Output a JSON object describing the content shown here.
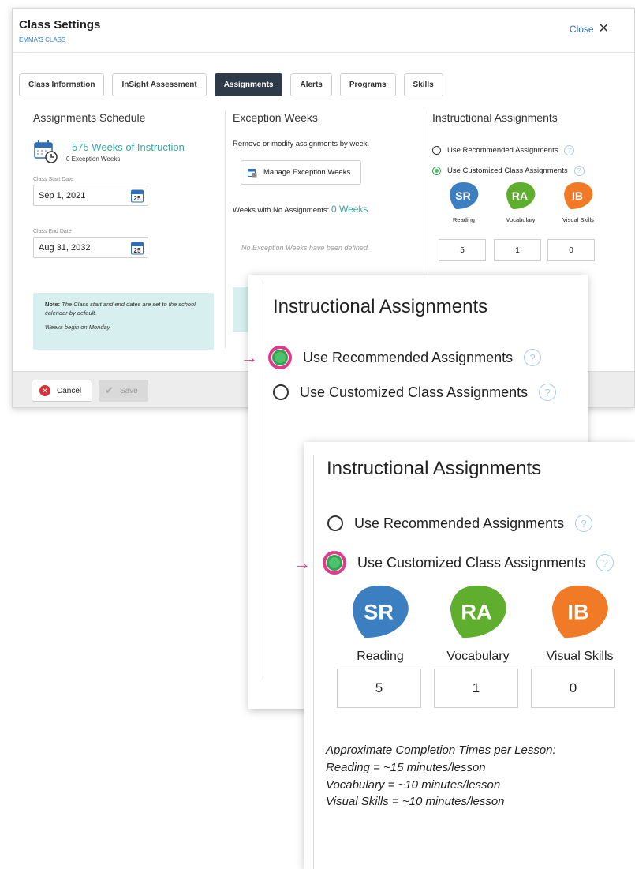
{
  "header": {
    "title": "Class Settings",
    "subtitle": "EMMA'S CLASS",
    "close_label": "Close"
  },
  "tabs": [
    {
      "label": "Class Information",
      "active": false
    },
    {
      "label": "InSight Assessment",
      "active": false
    },
    {
      "label": "Assignments",
      "active": true
    },
    {
      "label": "Alerts",
      "active": false
    },
    {
      "label": "Programs",
      "active": false
    },
    {
      "label": "Skills",
      "active": false
    }
  ],
  "schedule": {
    "title": "Assignments Schedule",
    "weeks_text": "575 Weeks of Instruction",
    "exception_weeks": "0 Exception Weeks",
    "start_label": "Class Start Date",
    "start_value": "Sep 1, 2021",
    "end_label": "Class End Date",
    "end_value": "Aug 31, 2032",
    "calendar_day": "25",
    "note_bold": "Note:",
    "note_text": "The Class start and end dates are set to the school calendar by default.",
    "note_text2": "Weeks begin on Monday."
  },
  "exceptions": {
    "title": "Exception Weeks",
    "description": "Remove or modify assignments by week.",
    "manage_button": "Manage Exception Weeks",
    "no_assign_label": "Weeks with No Assignments:",
    "no_assign_value": "0 Weeks",
    "empty_text": "No Exception Weeks have been defined."
  },
  "instructional": {
    "title": "Instructional Assignments",
    "option_recommended": "Use Recommended Assignments",
    "option_customized": "Use Customized Class Assignments",
    "help_glyph": "?",
    "courses": [
      {
        "label": "Reading",
        "logo_text": "SR",
        "color": "#3b7fc0",
        "value": "5"
      },
      {
        "label": "Vocabulary",
        "logo_text": "RA",
        "color": "#5fae2e",
        "value": "1"
      },
      {
        "label": "Visual Skills",
        "logo_text": "IB",
        "color": "#f07a26",
        "value": "0"
      }
    ],
    "approx_title": "Approximate Completion Times per Lesson:",
    "approx_lines": [
      "Reading = ~15 minutes/lesson",
      "Vocabulary = ~10 minutes/lesson",
      "Visual Skills = ~10 minutes/lesson"
    ]
  },
  "footer": {
    "cancel_label": "Cancel",
    "save_label": "Save"
  },
  "colors": {
    "accent_teal": "#3aa6a0",
    "active_tab": "#2e3a48",
    "highlight_pink": "#e03a8a",
    "radio_green": "#4cc36a"
  }
}
